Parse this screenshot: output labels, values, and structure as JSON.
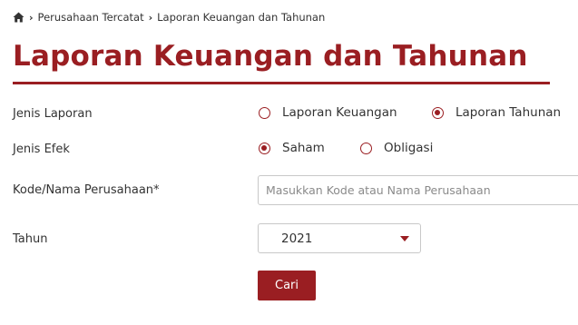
{
  "breadcrumb": {
    "home_icon": "home-icon",
    "items": [
      "Perusahaan Tercatat",
      "Laporan Keuangan dan Tahunan"
    ]
  },
  "page_title": "Laporan Keuangan dan Tahunan",
  "form": {
    "jenis_laporan": {
      "label": "Jenis Laporan",
      "options": [
        {
          "label": "Laporan Keuangan",
          "checked": false
        },
        {
          "label": "Laporan Tahunan",
          "checked": true
        }
      ]
    },
    "jenis_efek": {
      "label": "Jenis Efek",
      "options": [
        {
          "label": "Saham",
          "checked": true
        },
        {
          "label": "Obligasi",
          "checked": false
        }
      ]
    },
    "kode": {
      "label": "Kode/Nama Perusahaan*",
      "value": "",
      "placeholder": "Masukkan Kode atau Nama Perusahaan"
    },
    "tahun": {
      "label": "Tahun",
      "selected": "2021"
    },
    "submit_label": "Cari"
  },
  "colors": {
    "accent": "#9a1e22",
    "text": "#333333",
    "placeholder": "#8a8a8a",
    "border": "#c8c8c8"
  }
}
